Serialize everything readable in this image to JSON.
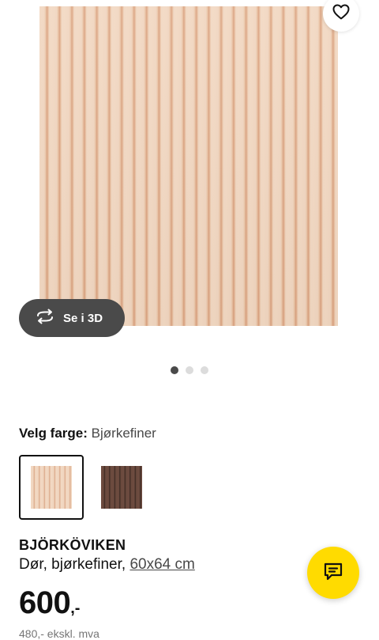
{
  "gallery": {
    "view_3d_label": "Se i 3D",
    "dots": [
      true,
      false,
      false
    ],
    "favourite_icon": "heart-icon"
  },
  "color_select": {
    "label": "Velg farge:",
    "value": "Bjørkefiner",
    "options": [
      {
        "name": "birch-veneer",
        "selected": true
      },
      {
        "name": "dark-brown",
        "selected": false
      }
    ]
  },
  "product": {
    "name": "BJÖRKÖVIKEN",
    "description": "Dør, bjørkefiner,",
    "size": "60x64 cm",
    "price_integer": "600",
    "price_suffix": ",-",
    "price_ex_vat": "480,- ekskl. mva"
  },
  "colors": {
    "chat_button": "#ffdb00",
    "button_3d": "#4a4a4a"
  },
  "chat": {
    "icon": "chat-icon"
  }
}
